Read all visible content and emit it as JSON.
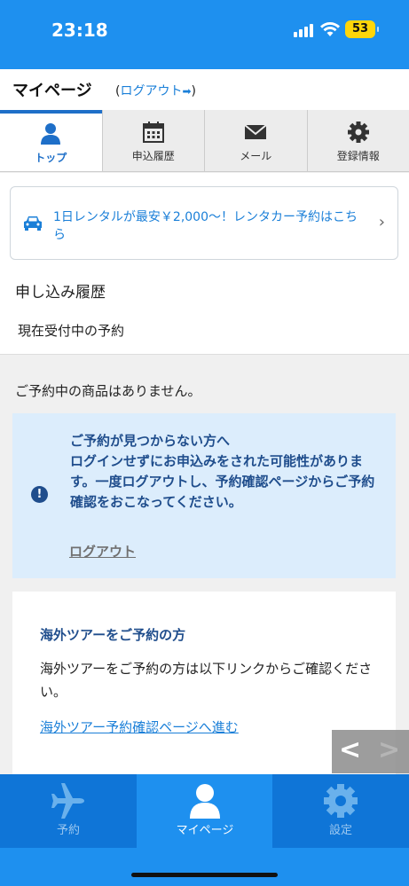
{
  "status_bar": {
    "time": "23:18",
    "battery": "53",
    "icons": [
      "signal-icon",
      "wifi-icon",
      "battery-icon"
    ]
  },
  "header": {
    "title": "マイページ",
    "logout_open": "(",
    "logout_label": "ログアウト",
    "logout_close": ")"
  },
  "tabs": [
    {
      "label": "トップ",
      "icon": "user-icon",
      "active": true
    },
    {
      "label": "申込履歴",
      "icon": "calendar-icon",
      "active": false
    },
    {
      "label": "メール",
      "icon": "mail-icon",
      "active": false
    },
    {
      "label": "登録情報",
      "icon": "gear-icon",
      "active": false
    }
  ],
  "rental_banner": {
    "text": "1日レンタルが最安￥2,000〜！レンタカー予約はこちら",
    "icon": "car-icon"
  },
  "history": {
    "title": "申し込み履歴",
    "subtitle": "現在受付中の予約",
    "empty_message": "ご予約中の商品はありません。"
  },
  "notice": {
    "text": "ご予約が見つからない方へ\nログインせずにお申込みをされた可能性があります。一度ログアウトし、予約確認ページからご予約確認をおこなってください。",
    "logout_link": "ログアウト",
    "icon": "info-icon"
  },
  "overseas": {
    "title": "海外ツアーをご予約の方",
    "body": "海外ツアーをご予約の方は以下リンクからご確認ください。",
    "link": "海外ツアー予約確認ページへ進む"
  },
  "float_nav": {
    "prev": "<",
    "next": ">"
  },
  "bottom_nav": [
    {
      "label": "予約",
      "icon": "airplane-icon",
      "active": false
    },
    {
      "label": "マイページ",
      "icon": "user-icon",
      "active": true
    },
    {
      "label": "設定",
      "icon": "gear-icon",
      "active": false
    }
  ],
  "colors": {
    "primary": "#1e90ef",
    "accent": "#1e6fc8",
    "link": "#1a7fd8",
    "notice_bg": "#dcedfc",
    "notice_text": "#1f4d8c",
    "battery": "#ffd60a"
  }
}
